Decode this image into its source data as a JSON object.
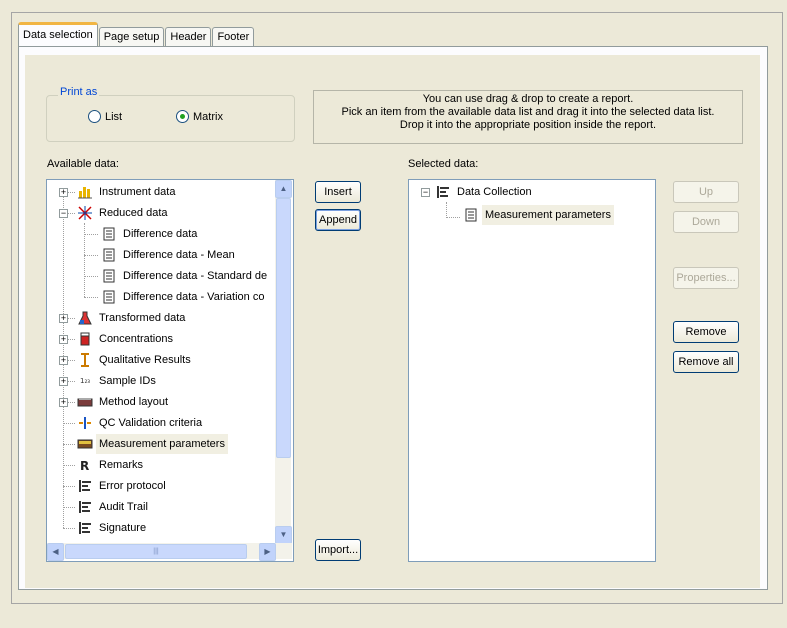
{
  "tabs": [
    "Data selection",
    "Page setup",
    "Header",
    "Footer"
  ],
  "print_as": {
    "legend": "Print as",
    "options": [
      {
        "label": "List",
        "selected": false
      },
      {
        "label": "Matrix",
        "selected": true
      }
    ]
  },
  "info": {
    "line1": "You can use drag & drop to create a report.",
    "line2": "Pick an item from the available data list and drag it into the selected data list.",
    "line3": "Drop it into the appropriate position inside the report."
  },
  "available": {
    "label": "Available data:",
    "items": [
      {
        "label": "Instrument data",
        "icon": "bar-chart-icon",
        "expander": "+",
        "level": 0
      },
      {
        "label": "Reduced data",
        "icon": "star-burst-icon",
        "expander": "-",
        "level": 0
      },
      {
        "label": "Difference data",
        "icon": "document-icon",
        "expander": "",
        "level": 1
      },
      {
        "label": "Difference data - Mean",
        "icon": "document-icon",
        "expander": "",
        "level": 1
      },
      {
        "label": "Difference data - Standard de",
        "icon": "document-icon",
        "expander": "",
        "level": 1
      },
      {
        "label": "Difference data - Variation co",
        "icon": "document-icon",
        "expander": "",
        "level": 1
      },
      {
        "label": "Transformed data",
        "icon": "flask-icon",
        "expander": "+",
        "level": 0
      },
      {
        "label": "Concentrations",
        "icon": "beaker-icon",
        "expander": "+",
        "level": 0
      },
      {
        "label": "Qualitative Results",
        "icon": "range-icon",
        "expander": "+",
        "level": 0
      },
      {
        "label": "Sample IDs",
        "icon": "numbering-icon",
        "expander": "+",
        "level": 0
      },
      {
        "label": "Method layout",
        "icon": "plate-icon",
        "expander": "+",
        "level": 0
      },
      {
        "label": "QC Validation criteria",
        "icon": "qc-icon",
        "expander": "",
        "level": 0
      },
      {
        "label": "Measurement parameters",
        "icon": "ruler-icon",
        "expander": "",
        "level": 0,
        "selected": true
      },
      {
        "label": "Remarks",
        "icon": "remarks-icon",
        "expander": "",
        "level": 0
      },
      {
        "label": "Error protocol",
        "icon": "list-icon",
        "expander": "",
        "level": 0
      },
      {
        "label": "Audit Trail",
        "icon": "list-icon",
        "expander": "",
        "level": 0
      },
      {
        "label": "Signature",
        "icon": "list-icon",
        "expander": "",
        "level": 0
      }
    ]
  },
  "middle_buttons": {
    "insert": "Insert",
    "append": "Append",
    "import": "Import..."
  },
  "selected": {
    "label": "Selected data:",
    "root": "Data Collection",
    "child": "Measurement parameters"
  },
  "right_buttons": {
    "up": "Up",
    "down": "Down",
    "properties": "Properties...",
    "remove": "Remove",
    "remove_all": "Remove all"
  },
  "scroll_glyphs": {
    "up": "▲",
    "down": "▼",
    "left": "◀",
    "right": "▶",
    "grip": "|||"
  }
}
